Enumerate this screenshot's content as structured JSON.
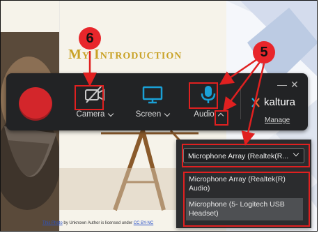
{
  "slide": {
    "title": "My Introduction",
    "caption_link": "This Photo",
    "caption_mid": " by Unknown Author is licensed under ",
    "caption_license": "CC BY-NC"
  },
  "recorder": {
    "camera_label": "Camera",
    "screen_label": "Screen",
    "audio_label": "Audio",
    "brand": "kaltura",
    "manage_label": "Manage",
    "minimize": "—",
    "close": "✕"
  },
  "audio_dropdown": {
    "selected_value": "Microphone Array (Realtek(R...",
    "options": [
      {
        "label": "Microphone Array (Realtek(R) Audio)"
      },
      {
        "label": "Microphone (5- Logitech USB Headset)"
      }
    ]
  },
  "annotations": {
    "badge_camera": "6",
    "badge_audio": "5"
  },
  "colors": {
    "record": "#d3262b",
    "accent": "#1aa0d6",
    "annotation": "#e02020",
    "title_gold": "#c9a227"
  }
}
